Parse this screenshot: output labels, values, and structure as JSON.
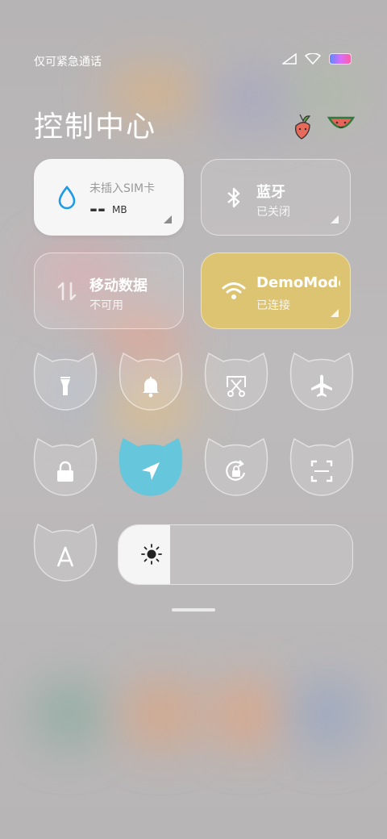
{
  "status_bar": {
    "carrier_text": "仅可紧急通话",
    "icons": [
      "signal-icon",
      "wifi-icon",
      "battery-icon"
    ]
  },
  "header": {
    "title": "控制中心",
    "decorations": [
      "carrot-sticker-icon",
      "watermelon-sticker-icon"
    ]
  },
  "tiles": {
    "data_usage": {
      "label": "未插入SIM卡",
      "value": "--",
      "unit": "MB",
      "icon": "water-drop-icon"
    },
    "bluetooth": {
      "label": "蓝牙",
      "status": "已关闭",
      "icon": "bluetooth-icon"
    },
    "mobile_data": {
      "label": "移动数据",
      "status": "不可用",
      "icon": "data-arrows-icon"
    },
    "wifi": {
      "label": "DemoMode",
      "status": "已连接",
      "icon": "wifi-icon",
      "active": true
    }
  },
  "toggles": [
    {
      "name": "flashlight",
      "icon": "flashlight-icon",
      "active": false
    },
    {
      "name": "ringer",
      "icon": "bell-icon",
      "active": false
    },
    {
      "name": "screenshot",
      "icon": "scissors-icon",
      "active": false
    },
    {
      "name": "airplane-mode",
      "icon": "airplane-icon",
      "active": false
    },
    {
      "name": "screen-lock",
      "icon": "lock-icon",
      "active": false
    },
    {
      "name": "location",
      "icon": "location-arrow-icon",
      "active": true
    },
    {
      "name": "auto-rotate",
      "icon": "rotation-lock-icon",
      "active": false
    },
    {
      "name": "scanner",
      "icon": "scan-icon",
      "active": false
    },
    {
      "name": "auto-brightness",
      "icon": "letter-a-icon",
      "active": false
    }
  ],
  "brightness": {
    "level": 0.22,
    "icon": "sun-icon"
  },
  "colors": {
    "active_tile": "#dcc472",
    "active_toggle": "#66c6dc",
    "accent_blue": "#1e9be8"
  }
}
